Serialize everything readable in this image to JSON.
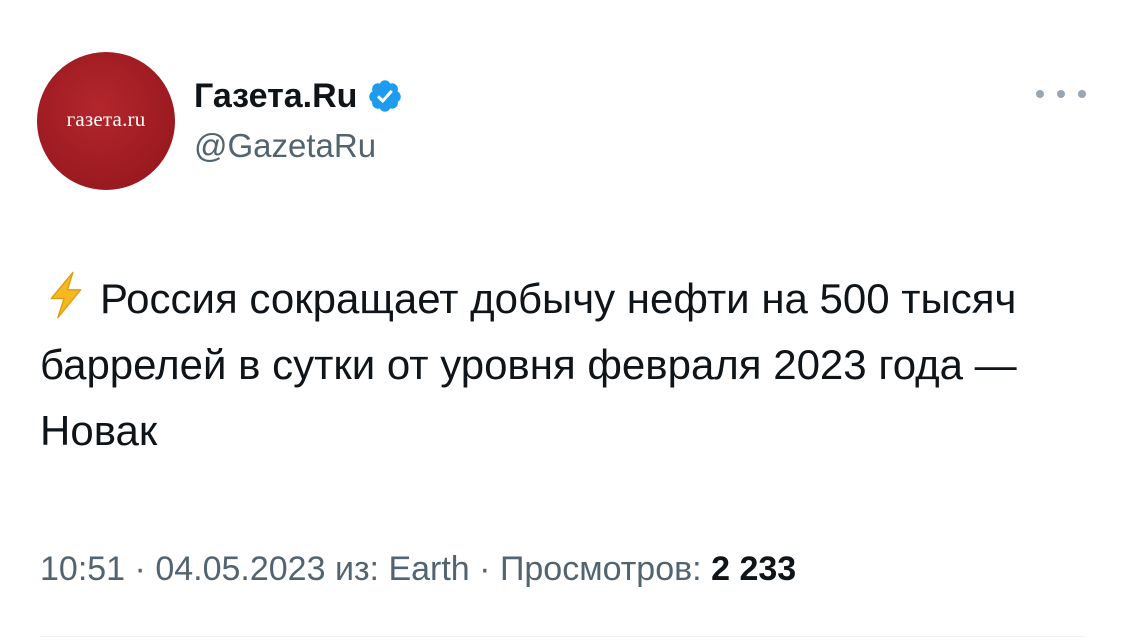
{
  "author": {
    "avatar_text": "газета.ru",
    "display_name": "Газета.Ru",
    "handle": "@GazetaRu",
    "verified": true
  },
  "tweet": {
    "emoji_icon": "lightning-bolt-icon",
    "text": "Россия сокращает добычу нефти на 500 тысяч баррелей в сутки от уровня февраля 2023 года — Новак"
  },
  "meta": {
    "time": "10:51",
    "separator": "·",
    "date": "04.05.2023",
    "source_prefix": "из:",
    "source": "Earth",
    "views_label": "Просмотров:",
    "views_count": "2 233"
  },
  "colors": {
    "avatar_bg": "#9e1c22",
    "verified_badge": "#1d9bf0",
    "text_primary": "#0f1419",
    "text_secondary": "#536471",
    "more_dots": "#9aa6b0",
    "bolt": "#f5b81e"
  },
  "icons": {
    "more": "more-horizontal-icon",
    "verified": "verified-badge-icon"
  }
}
